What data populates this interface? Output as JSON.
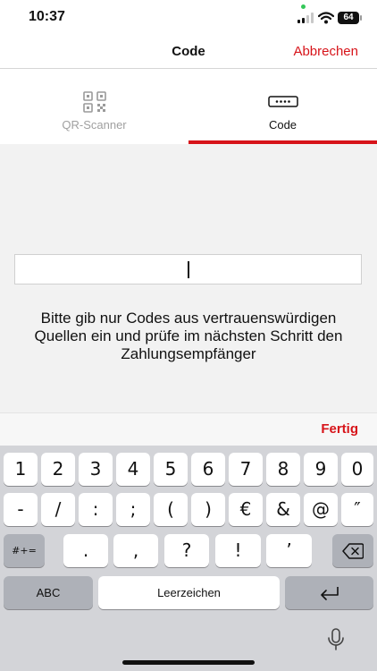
{
  "status_bar": {
    "time": "10:37",
    "battery": "64"
  },
  "nav": {
    "title": "Code",
    "cancel_label": "Abbrechen"
  },
  "tabs": [
    {
      "label": "QR-Scanner",
      "icon": "qr-code-icon",
      "active": false
    },
    {
      "label": "Code",
      "icon": "code-field-icon",
      "active": true
    }
  ],
  "code_input": {
    "value": "",
    "placeholder": ""
  },
  "info_text": "Bitte gib nur Codes aus vertrauenswürdigen Quellen ein und prüfe im nächsten Schritt den Zahlungsempfänger",
  "toolbar": {
    "done_label": "Fertig"
  },
  "keyboard": {
    "row1": [
      "1",
      "2",
      "3",
      "4",
      "5",
      "6",
      "7",
      "8",
      "9",
      "0"
    ],
    "row2": [
      "-",
      "/",
      ":",
      ";",
      "(",
      ")",
      "€",
      "&",
      "@",
      "″"
    ],
    "row3": {
      "symbols_label": "#+=",
      "keys": [
        ".",
        ",",
        "?",
        "!",
        "’"
      ]
    },
    "row4": {
      "abc_label": "ABC",
      "space_label": "Leerzeichen"
    }
  },
  "colors": {
    "accent": "#d7141a",
    "keyboard_bg": "#d3d4d8"
  }
}
